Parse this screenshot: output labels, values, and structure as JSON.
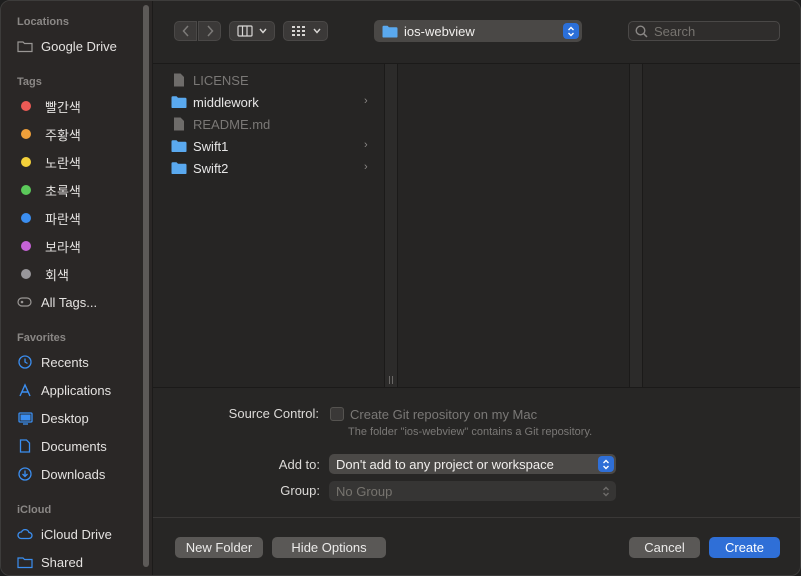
{
  "sidebar": {
    "locations_title": "Locations",
    "locations": [
      {
        "label": "Google Drive",
        "icon": "folder-icon"
      }
    ],
    "tags_title": "Tags",
    "tags": [
      {
        "label": "빨간색",
        "color": "#ec5a55"
      },
      {
        "label": "주황색",
        "color": "#f0a03a"
      },
      {
        "label": "노란색",
        "color": "#f4d13a"
      },
      {
        "label": "초록색",
        "color": "#5bc95a"
      },
      {
        "label": "파란색",
        "color": "#3b8ef0"
      },
      {
        "label": "보라색",
        "color": "#c663d6"
      },
      {
        "label": "회색",
        "color": "#98969a"
      }
    ],
    "all_tags": "All Tags...",
    "favorites_title": "Favorites",
    "favorites": [
      {
        "label": "Recents",
        "icon": "clock-icon"
      },
      {
        "label": "Applications",
        "icon": "applications-icon"
      },
      {
        "label": "Desktop",
        "icon": "desktop-icon"
      },
      {
        "label": "Documents",
        "icon": "document-icon"
      },
      {
        "label": "Downloads",
        "icon": "download-icon"
      }
    ],
    "icloud_title": "iCloud",
    "icloud": [
      {
        "label": "iCloud Drive",
        "icon": "cloud-icon"
      },
      {
        "label": "Shared",
        "icon": "shared-folder-icon"
      }
    ]
  },
  "toolbar": {
    "path": "ios-webview",
    "search_placeholder": "Search"
  },
  "files": [
    {
      "name": "LICENSE",
      "type": "file",
      "dim": true
    },
    {
      "name": "middlework",
      "type": "folder",
      "dim": false
    },
    {
      "name": "README.md",
      "type": "file",
      "dim": true
    },
    {
      "name": "Swift1",
      "type": "folder",
      "dim": false
    },
    {
      "name": "Swift2",
      "type": "folder",
      "dim": false
    }
  ],
  "form": {
    "source_control_label": "Source Control:",
    "git_checkbox_label": "Create Git repository on my Mac",
    "git_note": "The folder \"ios-webview\" contains a Git repository.",
    "add_to_label": "Add to:",
    "add_to_value": "Don't add to any project or workspace",
    "group_label": "Group:",
    "group_value": "No Group"
  },
  "buttons": {
    "new_folder": "New Folder",
    "hide_options": "Hide Options",
    "cancel": "Cancel",
    "create": "Create"
  },
  "colors": {
    "accent": "#2f6fd7",
    "folder": "#5aa9ef"
  }
}
